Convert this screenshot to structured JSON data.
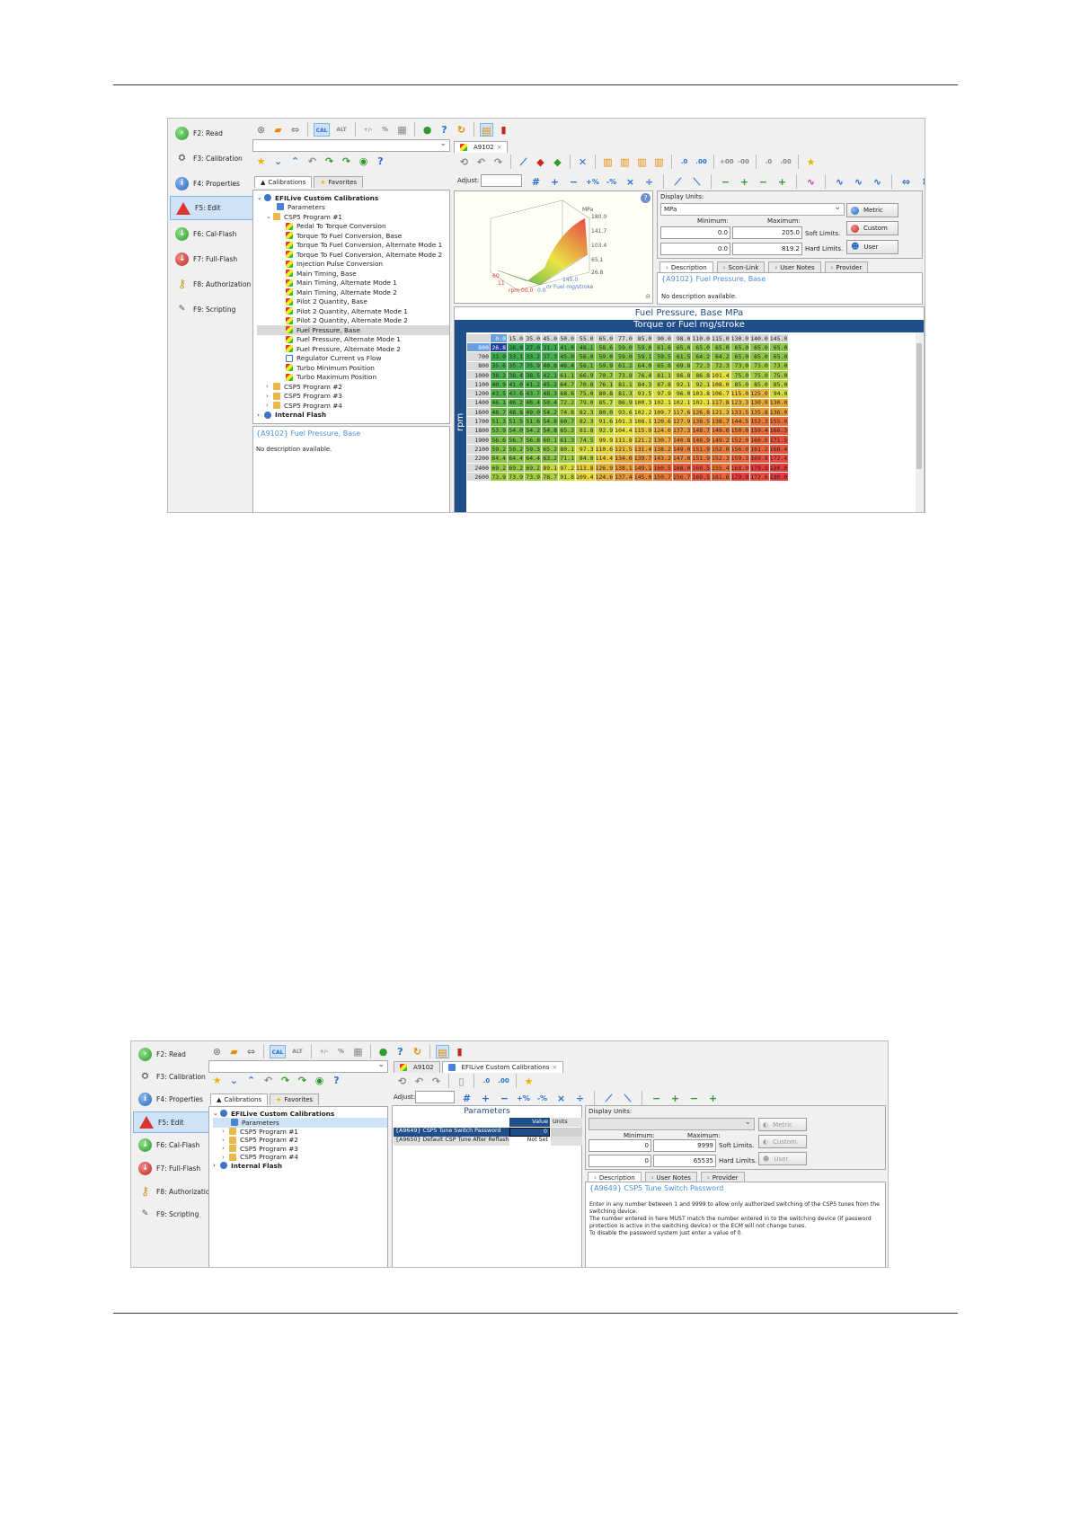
{
  "nav": {
    "items": [
      {
        "label": "F2: Read",
        "icon": "read-icon"
      },
      {
        "label": "F3: Calibration",
        "icon": "calibration-icon"
      },
      {
        "label": "F4: Properties",
        "icon": "info-icon"
      },
      {
        "label": "F5: Edit",
        "icon": "edit-icon"
      },
      {
        "label": "F6: Cal-Flash",
        "icon": "cal-flash-icon"
      },
      {
        "label": "F7: Full-Flash",
        "icon": "full-flash-icon"
      },
      {
        "label": "F8: Authorization",
        "icon": "key-icon"
      },
      {
        "label": "F9: Scripting",
        "icon": "scripting-icon"
      }
    ],
    "selected": "F5: Edit"
  },
  "toolbar": {
    "cal": "CAL",
    "alt": "ALT",
    "plusminus": "+/-",
    "percent": "%"
  },
  "left_tabs": {
    "calibrations": "Calibrations",
    "favorites": "Favorites"
  },
  "tree": {
    "root": "EFILive Custom Calibrations",
    "parameters": "Parameters",
    "program1": "CSP5 Program #1",
    "program1_items": [
      "Pedal To Torque Conversion",
      "Torque To Fuel Conversion, Base",
      "Torque To Fuel Conversion, Alternate Mode 1",
      "Torque To Fuel Conversion, Alternate Mode 2",
      "Injection Pulse Conversion",
      "Main Timing, Base",
      "Main Timing, Alternate Mode 1",
      "Main Timing, Alternate Mode 2",
      "Pilot 2 Quantity, Base",
      "Pilot 2 Quantity, Alternate Mode 1",
      "Pilot 2 Quantity, Alternate Mode 2",
      "Fuel Pressure, Base",
      "Fuel Pressure, Alternate Mode 1",
      "Fuel Pressure, Alternate Mode 2",
      "Regulator Current vs Flow",
      "Turbo Minimum Position",
      "Turbo Maximum Position"
    ],
    "program2": "CSP5 Program #2",
    "program3": "CSP5 Program #3",
    "program4": "CSP5 Program #4",
    "internal_flash": "Internal Flash",
    "program1_short": "CSP5 Program #1"
  },
  "shot1": {
    "tab": "A9102",
    "adjust_label": "Adjust:",
    "bottom_desc_title": "{A9102} Fuel Pressure, Base",
    "bottom_desc_text": "No description available.",
    "display_units_label": "Display Units:",
    "units_value": "MPa",
    "minimum_label": "Minimum:",
    "maximum_label": "Maximum:",
    "soft_min": "0.0",
    "soft_max": "205.0",
    "hard_min": "0.0",
    "hard_max": "819.2",
    "soft_label": "Soft Limits.",
    "hard_label": "Hard Limits.",
    "metric_btn": "Metric",
    "custom_btn": "Custom",
    "user_btn": "User",
    "desc_tabs": [
      "Description",
      "Scon-Link",
      "User Notes",
      "Provider"
    ],
    "desc_title": "{A9102} Fuel Pressure, Base",
    "desc_text": "No description available.",
    "surface_z_unit": "MPa",
    "surface_z_ticks": [
      "180.0",
      "141.7",
      "103.4",
      "65.1",
      "26.8"
    ],
    "surface_x_label": "or Fuel mg/stroke",
    "surface_y_label": "rpm",
    "surface_corner_ticks": [
      "60",
      "11",
      "145.0",
      "0.0",
      "rpm 00.0"
    ],
    "table_title": "Fuel Pressure, Base MPa",
    "axis_title": "Torque or Fuel mg/stroke",
    "row_axis": "rpm",
    "columns": [
      "0.0",
      "15.0",
      "35.0",
      "45.0",
      "50.0",
      "55.0",
      "65.0",
      "77.0",
      "85.0",
      "90.0",
      "98.0",
      "110.0",
      "115.0",
      "130.0",
      "140.0",
      "145.0"
    ],
    "rows": [
      {
        "rpm": "600",
        "v": [
          "26.8",
          "26.8",
          "27.0",
          "31.1",
          "41.0",
          "48.1",
          "58.6",
          "59.0",
          "59.0",
          "61.6",
          "65.0",
          "65.0",
          "65.0",
          "65.0",
          "65.0",
          "65.0"
        ]
      },
      {
        "rpm": "700",
        "v": [
          "33.0",
          "33.1",
          "33.2",
          "37.3",
          "45.0",
          "56.0",
          "59.0",
          "59.0",
          "59.1",
          "59.5",
          "61.5",
          "64.2",
          "64.2",
          "65.0",
          "65.0",
          "65.0"
        ]
      },
      {
        "rpm": "800",
        "v": [
          "35.6",
          "35.7",
          "35.9",
          "40.8",
          "46.4",
          "56.1",
          "59.9",
          "61.2",
          "64.0",
          "65.8",
          "69.8",
          "72.3",
          "72.3",
          "73.0",
          "73.0",
          "73.0"
        ]
      },
      {
        "rpm": "1000",
        "v": [
          "38.2",
          "38.4",
          "38.5",
          "42.1",
          "61.1",
          "66.9",
          "70.7",
          "73.8",
          "76.4",
          "81.1",
          "86.8",
          "86.8",
          "101.4",
          "75.0",
          "75.0",
          "75.0"
        ]
      },
      {
        "rpm": "1100",
        "v": [
          "40.9",
          "41.0",
          "41.2",
          "45.2",
          "64.7",
          "70.8",
          "76.1",
          "81.1",
          "84.3",
          "87.8",
          "92.1",
          "92.1",
          "108.0",
          "85.0",
          "85.0",
          "85.0"
        ]
      },
      {
        "rpm": "1200",
        "v": [
          "43.5",
          "43.6",
          "43.7",
          "48.3",
          "68.6",
          "75.0",
          "80.8",
          "81.3",
          "93.5",
          "97.9",
          "96.0",
          "103.8",
          "106.7",
          "115.0",
          "125.0",
          "94.0"
        ]
      },
      {
        "rpm": "1400",
        "v": [
          "46.1",
          "46.2",
          "46.4",
          "50.4",
          "72.2",
          "79.0",
          "85.7",
          "86.9",
          "100.3",
          "102.1",
          "102.1",
          "102.1",
          "117.8",
          "123.3",
          "130.0",
          "130.0"
        ]
      },
      {
        "rpm": "1600",
        "v": [
          "48.7",
          "48.8",
          "49.0",
          "54.2",
          "74.8",
          "82.3",
          "80.0",
          "93.6",
          "102.2",
          "109.7",
          "117.6",
          "126.8",
          "121.3",
          "133.5",
          "135.8",
          "136.0"
        ]
      },
      {
        "rpm": "1700",
        "v": [
          "51.3",
          "51.5",
          "51.6",
          "54.8",
          "60.7",
          "82.3",
          "91.6",
          "101.3",
          "108.1",
          "120.6",
          "127.9",
          "138.5",
          "138.7",
          "144.5",
          "152.3",
          "155.0"
        ]
      },
      {
        "rpm": "1800",
        "v": [
          "53.9",
          "54.0",
          "54.2",
          "54.8",
          "65.3",
          "81.8",
          "92.9",
          "104.4",
          "115.9",
          "124.0",
          "137.3",
          "148.7",
          "149.0",
          "150.0",
          "159.4",
          "166.3"
        ]
      },
      {
        "rpm": "1900",
        "v": [
          "56.6",
          "56.7",
          "56.8",
          "60.1",
          "61.3",
          "74.5",
          "99.9",
          "111.8",
          "121.2",
          "130.7",
          "140.8",
          "148.9",
          "149.2",
          "152.0",
          "160.0",
          "171.5"
        ]
      },
      {
        "rpm": "2100",
        "v": [
          "59.2",
          "59.2",
          "59.3",
          "65.2",
          "80.1",
          "97.3",
          "110.6",
          "121.5",
          "131.4",
          "138.2",
          "149.0",
          "151.9",
          "152.0",
          "156.0",
          "161.2",
          "168.4"
        ]
      },
      {
        "rpm": "2200",
        "v": [
          "64.4",
          "64.4",
          "64.4",
          "63.2",
          "71.1",
          "84.0",
          "114.4",
          "134.0",
          "139.7",
          "143.2",
          "147.0",
          "151.9",
          "152.3",
          "159.3",
          "169.8",
          "172.4"
        ]
      },
      {
        "rpm": "2400",
        "v": [
          "69.2",
          "69.2",
          "69.2",
          "89.1",
          "97.2",
          "113.8",
          "126.9",
          "138.1",
          "149.1",
          "160.5",
          "168.0",
          "168.5",
          "155.4",
          "168.0",
          "179.9",
          "180.0"
        ]
      },
      {
        "rpm": "2600",
        "v": [
          "73.9",
          "73.9",
          "73.9",
          "78.7",
          "91.8",
          "109.4",
          "124.6",
          "137.4",
          "145.0",
          "150.7",
          "156.7",
          "169.5",
          "161.6",
          "179.9",
          "172.6",
          "180.0"
        ]
      }
    ],
    "colors": {
      "low": "#2fa84f",
      "mid": "#e8e23a",
      "high": "#e83c3c",
      "selected": "#1f3f9c"
    }
  },
  "shot2": {
    "tab1": "A9102",
    "tab2": "EFILive Custom Calibrations",
    "adjust_label": "Adjust:",
    "params_title": "Parameters",
    "col_value": "Value",
    "col_units": "Units",
    "params": [
      {
        "name": "{A9649} CSP5 Tune Switch Password",
        "value": "0",
        "units": ""
      },
      {
        "name": "{A9650} Default CSP Tune After Reflash",
        "value": "Not Set",
        "units": ""
      }
    ],
    "display_units_label": "Display Units:",
    "minimum_label": "Minimum:",
    "maximum_label": "Maximum:",
    "soft_min": "0",
    "soft_max": "9999",
    "hard_min": "0",
    "hard_max": "65535",
    "soft_label": "Soft Limits.",
    "hard_label": "Hard Limits.",
    "metric_btn": "Metric",
    "custom_btn": "Custom",
    "user_btn": "User",
    "desc_tabs": [
      "Description",
      "User Notes",
      "Provider"
    ],
    "desc_title": "{A9649} CSP5 Tune Switch Password",
    "desc_lines": [
      "Enter in any number between 1 and 9999 to allow only authorized switching of the CSP5 tunes from the",
      "switching device.",
      "The number entered in here MUST match the number entered in to the switching device (if password",
      "protection is active in the switching device) or the ECM will not change tunes.",
      "To disable the password system just enter a value of 0."
    ]
  }
}
